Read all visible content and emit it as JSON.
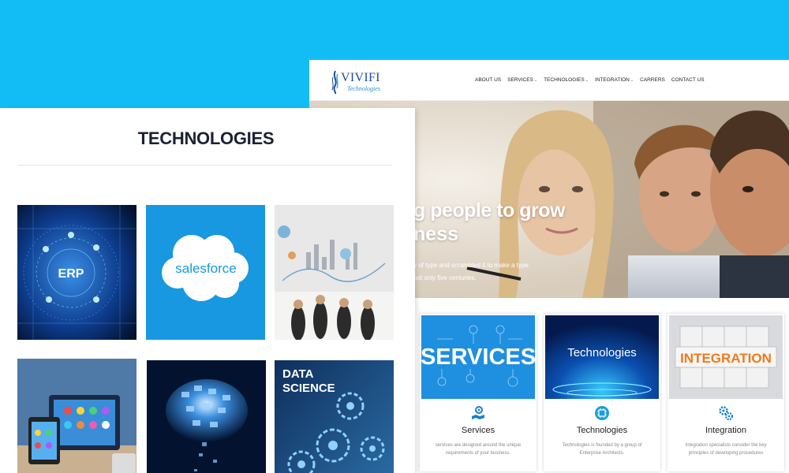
{
  "site": {
    "logo": {
      "name": "VIVIFI",
      "subtitle": "Technologies"
    },
    "nav": [
      {
        "label": "ABOUT US",
        "dropdown": false
      },
      {
        "label": "SERVICES",
        "dropdown": true
      },
      {
        "label": "TECHNOLOGIES",
        "dropdown": true
      },
      {
        "label": "INTEGRATION",
        "dropdown": true
      },
      {
        "label": "CARRERS",
        "dropdown": false
      },
      {
        "label": "CONTACT US",
        "dropdown": false
      }
    ],
    "hero": {
      "heading_line1": "g people to grow",
      "heading_line2": "ness",
      "sub_line1": "y of type and scrambled it to make a type",
      "sub_line2": "not only five centuries."
    },
    "cards": [
      {
        "image_text": "SERVICES",
        "title": "Services",
        "desc": "services are designed around the unique requirements of your business.",
        "icon": "services-icon"
      },
      {
        "image_text": "Technologies",
        "title": "Technologies",
        "desc": "Technologies is founded by a group of Enterprise Architects.",
        "icon": "technologies-icon"
      },
      {
        "image_text": "INTEGRATION",
        "title": "Integration",
        "desc": "Integration specialists consider the key principles of developing procedures",
        "icon": "integration-icon"
      }
    ]
  },
  "tech_page": {
    "title": "TECHNOLOGIES",
    "tiles": [
      {
        "name": "erp",
        "label": "ERP"
      },
      {
        "name": "salesforce",
        "label": "salesforce"
      },
      {
        "name": "analytics",
        "label": ""
      },
      {
        "name": "mobile-apps",
        "label": ""
      },
      {
        "name": "cloud",
        "label": ""
      },
      {
        "name": "data-science",
        "label_line1": "DATA",
        "label_line2": "SCIENCE"
      }
    ]
  },
  "colors": {
    "background": "#12bdf5",
    "logo_blue": "#1d4f9a",
    "salesforce_blue": "#1798e0",
    "integration_orange": "#f07a1a",
    "tech_title": "#1a2233"
  }
}
